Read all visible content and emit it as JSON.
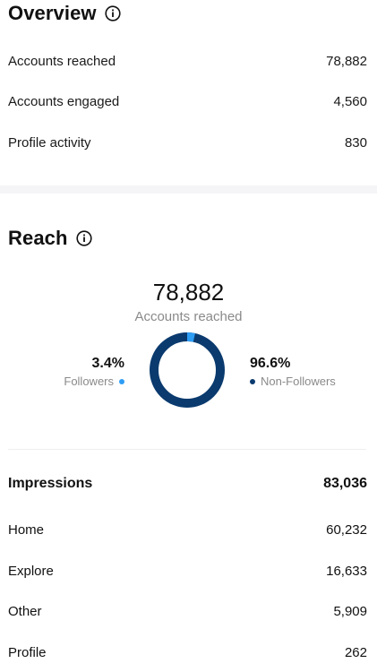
{
  "overview": {
    "title": "Overview",
    "stats": [
      {
        "label": "Accounts reached",
        "value": "78,882"
      },
      {
        "label": "Accounts engaged",
        "value": "4,560"
      },
      {
        "label": "Profile activity",
        "value": "830"
      }
    ]
  },
  "reach": {
    "title": "Reach",
    "total": "78,882",
    "total_label": "Accounts reached",
    "followers": {
      "pct_label": "3.4%",
      "label": "Followers",
      "fraction": 0.034,
      "color": "#2e9df4"
    },
    "non_followers": {
      "pct_label": "96.6%",
      "label": "Non-Followers",
      "fraction": 0.966,
      "color": "#0a3a6e"
    }
  },
  "impressions": {
    "header": {
      "label": "Impressions",
      "value": "83,036"
    },
    "rows": [
      {
        "label": "Home",
        "value": "60,232"
      },
      {
        "label": "Explore",
        "value": "16,633"
      },
      {
        "label": "Other",
        "value": "5,909"
      },
      {
        "label": "Profile",
        "value": "262"
      }
    ]
  },
  "icons": {
    "info": "info-circle-icon"
  }
}
